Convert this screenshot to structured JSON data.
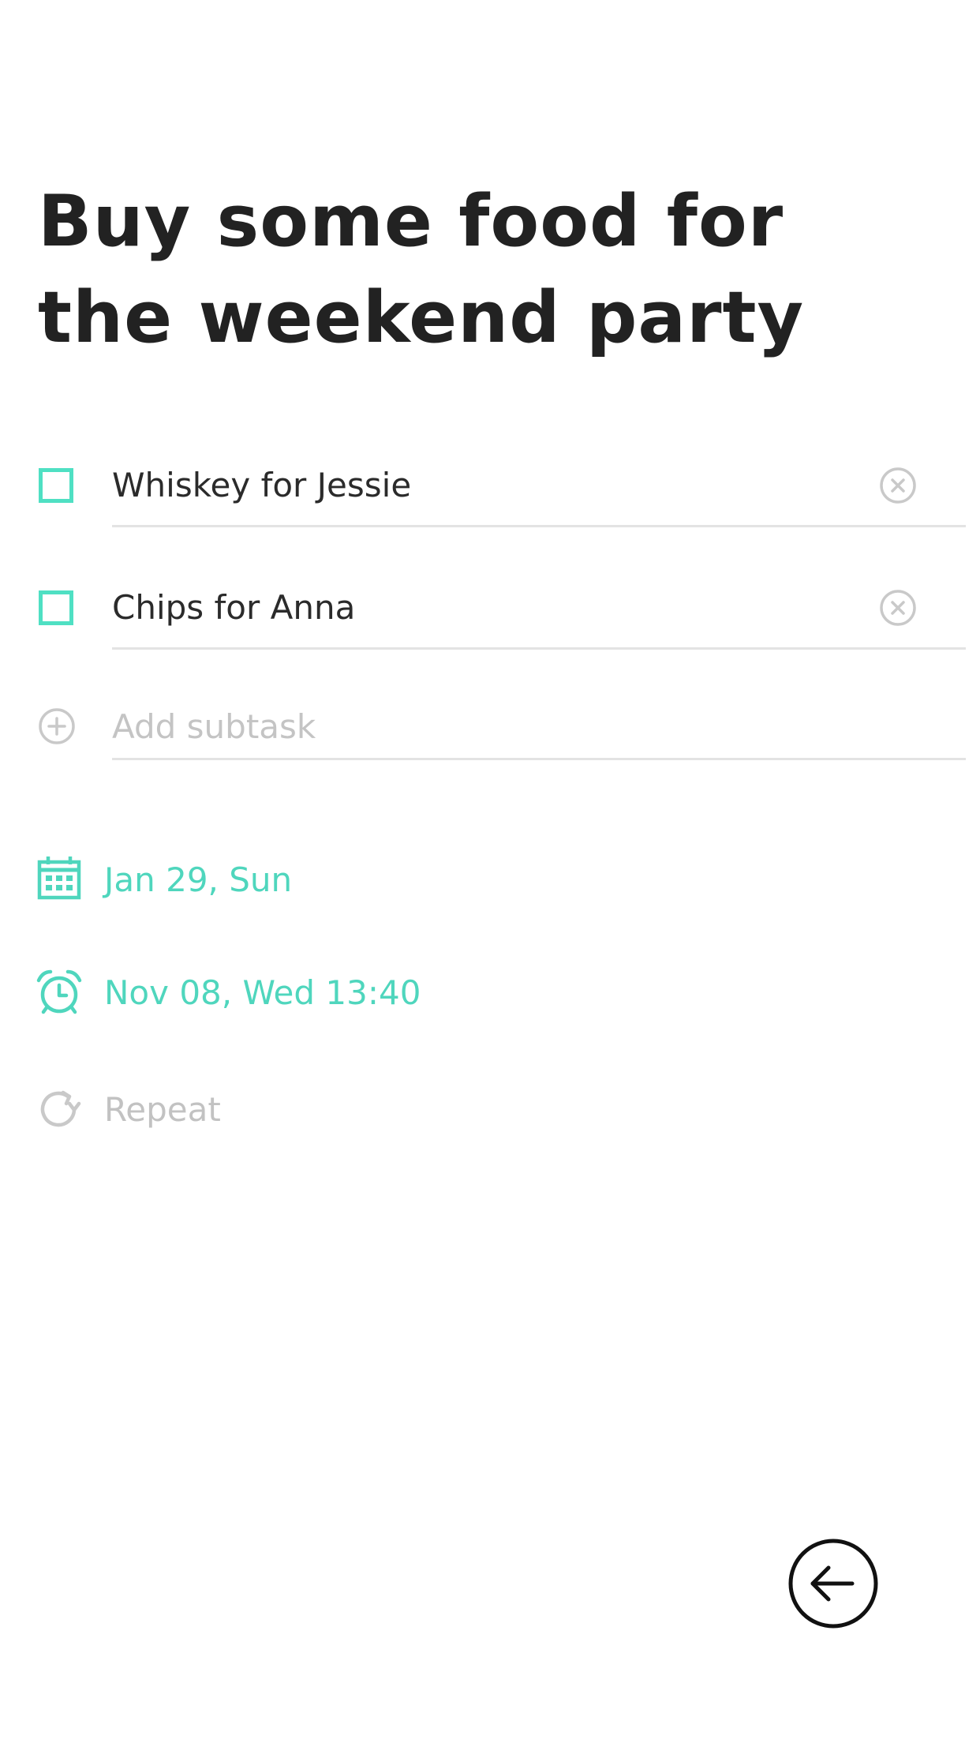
{
  "task": {
    "title": "Buy some food for the weekend party"
  },
  "subtasks": [
    {
      "label": "Whiskey for Jessie",
      "checked": false
    },
    {
      "label": "Chips for Anna",
      "checked": false
    }
  ],
  "add_subtask": {
    "placeholder": "Add subtask"
  },
  "due_date": {
    "label": "Jan 29, Sun",
    "icon": "calendar-icon"
  },
  "reminder": {
    "label": "Nov 08, Wed 13:40",
    "icon": "alarm-clock-icon"
  },
  "repeat": {
    "label": "Repeat",
    "icon": "repeat-icon"
  },
  "navigation": {
    "back_icon": "arrow-left-icon"
  },
  "colors": {
    "accent": "#4fd6bd",
    "title": "#222222",
    "text": "#2b2b2b",
    "muted": "#c2c2c2",
    "divider": "#e3e3e3"
  }
}
